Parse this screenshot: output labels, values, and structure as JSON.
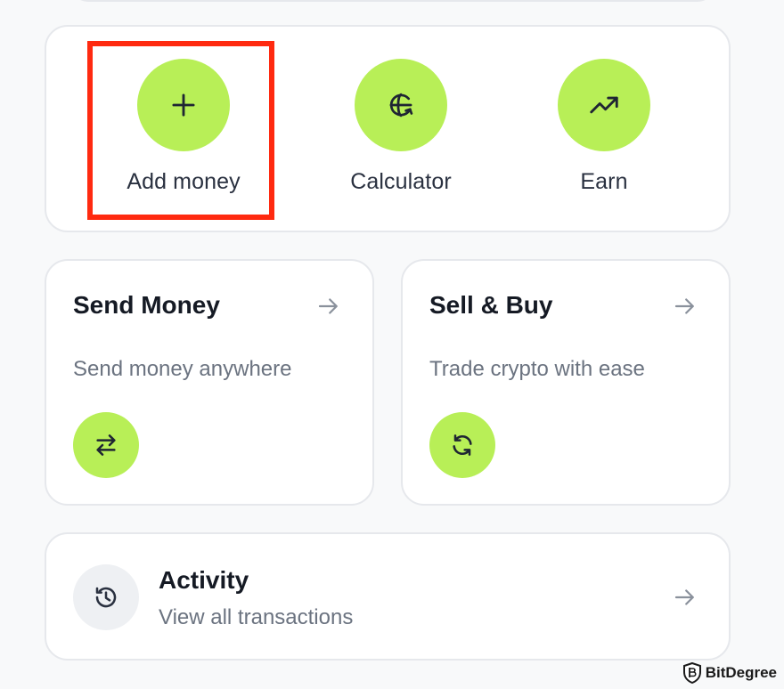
{
  "colors": {
    "accent": "#b8ef57",
    "highlight": "#ff2a10",
    "card_border": "#e6e8ec",
    "title_text": "#151a24",
    "muted_text": "#6b7380",
    "icon_muted": "#8a919c"
  },
  "quick_actions": [
    {
      "label": "Add money",
      "icon": "plus-icon"
    },
    {
      "label": "Calculator",
      "icon": "calculator-globe-icon"
    },
    {
      "label": "Earn",
      "icon": "trending-up-icon"
    }
  ],
  "send_card": {
    "title": "Send Money",
    "subtitle": "Send money anywhere",
    "icon": "transfer-arrows-icon",
    "arrow_icon": "arrow-right-icon"
  },
  "sell_card": {
    "title": "Sell & Buy",
    "subtitle": "Trade crypto with ease",
    "icon": "refresh-icon",
    "arrow_icon": "arrow-right-icon"
  },
  "activity": {
    "title": "Activity",
    "subtitle": "View all transactions",
    "icon": "history-icon",
    "arrow_icon": "arrow-right-icon"
  },
  "watermark": {
    "text": "BitDegree"
  }
}
